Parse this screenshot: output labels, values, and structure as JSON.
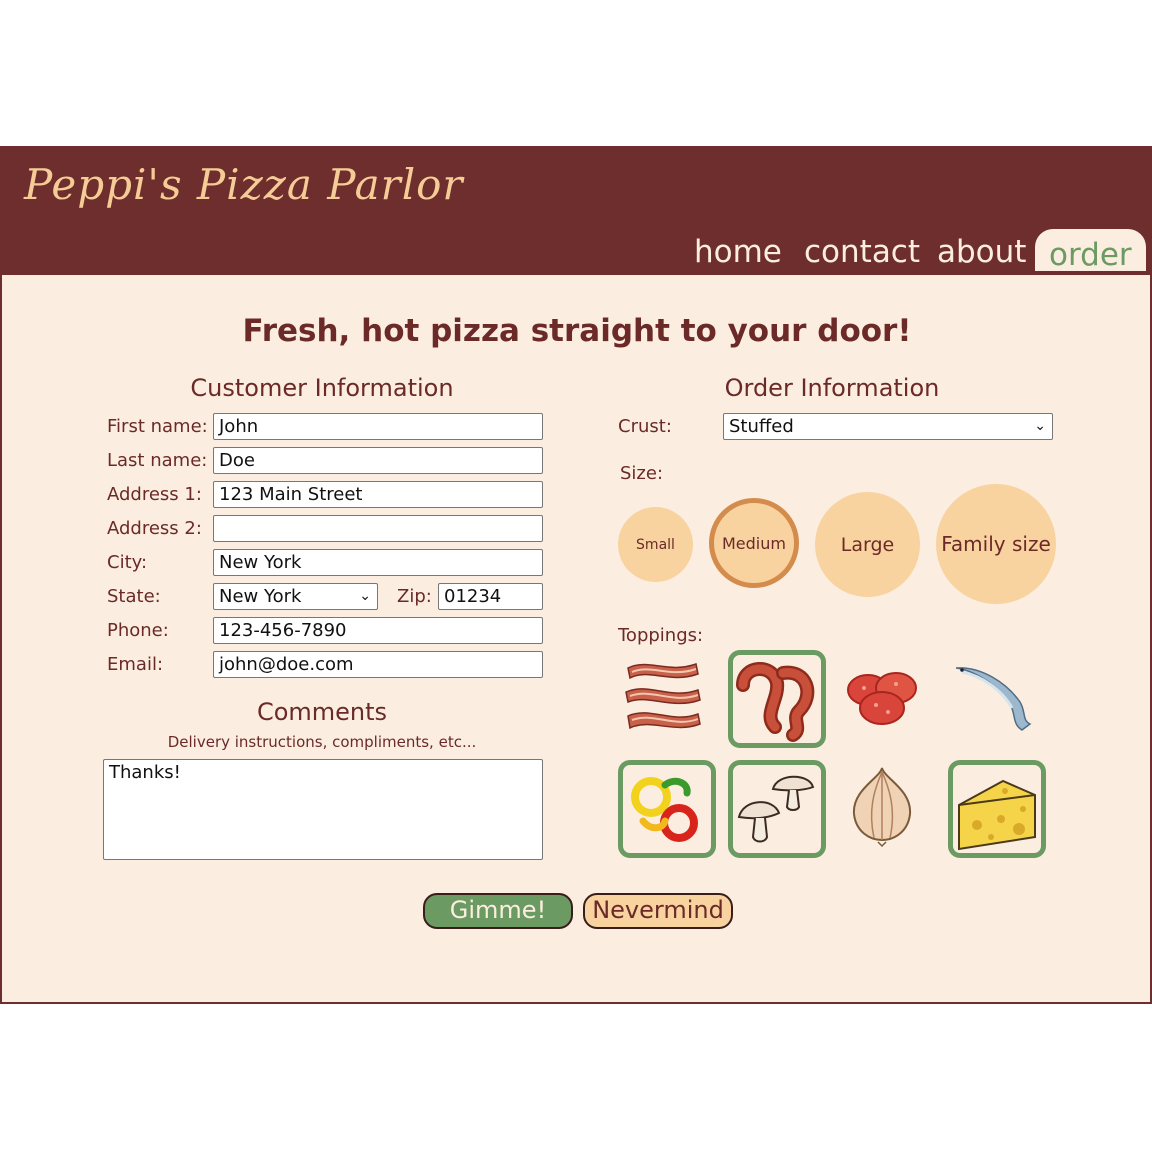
{
  "site": {
    "title": "Peppi's Pizza Parlor"
  },
  "nav": {
    "items": [
      {
        "label": "home"
      },
      {
        "label": "contact"
      },
      {
        "label": "about"
      },
      {
        "label": "order"
      }
    ],
    "active": "order"
  },
  "main": {
    "tagline": "Fresh, hot pizza straight to your door!"
  },
  "customer": {
    "title": "Customer Information",
    "first_name_label": "First name:",
    "first_name": "John",
    "last_name_label": "Last name:",
    "last_name": "Doe",
    "address1_label": "Address 1:",
    "address1": "123 Main Street",
    "address2_label": "Address 2:",
    "address2": "",
    "city_label": "City:",
    "city": "New York",
    "state_label": "State:",
    "state": "New York",
    "zip_label": "Zip:",
    "zip": "01234",
    "phone_label": "Phone:",
    "phone": "123-456-7890",
    "email_label": "Email:",
    "email": "john@doe.com"
  },
  "comments": {
    "title": "Comments",
    "hint": "Delivery instructions, compliments, etc...",
    "value": "Thanks!"
  },
  "order": {
    "title": "Order Information",
    "crust_label": "Crust:",
    "crust": "Stuffed",
    "size_label": "Size:",
    "sizes": [
      {
        "label": "Small",
        "selected": false
      },
      {
        "label": "Medium",
        "selected": true
      },
      {
        "label": "Large",
        "selected": false
      },
      {
        "label": "Family size",
        "selected": false
      }
    ],
    "toppings_label": "Toppings:",
    "toppings": [
      {
        "name": "bacon",
        "selected": false
      },
      {
        "name": "sausage",
        "selected": true
      },
      {
        "name": "pepperoni",
        "selected": false
      },
      {
        "name": "anchovies",
        "selected": false
      },
      {
        "name": "peppers",
        "selected": true
      },
      {
        "name": "mushrooms",
        "selected": true
      },
      {
        "name": "onion",
        "selected": false
      },
      {
        "name": "cheese",
        "selected": true
      }
    ]
  },
  "actions": {
    "submit_label": "Gimme!",
    "cancel_label": "Nevermind"
  },
  "colors": {
    "header": "#6e2e2d",
    "page": "#fbeee0",
    "accent_green": "#6b9a62",
    "peach": "#f8d3a0",
    "text": "#6b2a28"
  }
}
